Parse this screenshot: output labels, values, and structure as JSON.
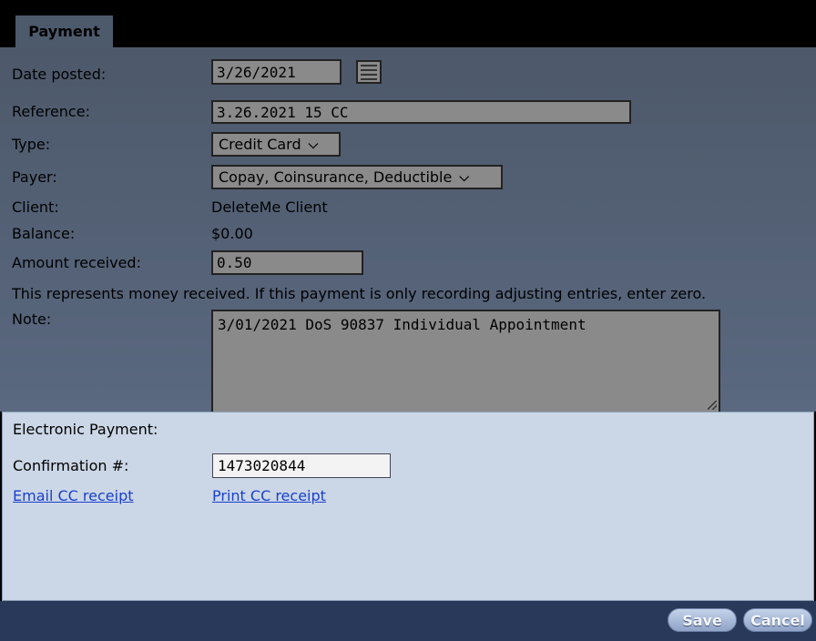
{
  "tab": {
    "label": "Payment"
  },
  "form": {
    "date_posted": {
      "label": "Date posted:",
      "value": "3/26/2021",
      "icon": "calendar-icon"
    },
    "reference": {
      "label": "Reference:",
      "value": "3.26.2021 15 CC"
    },
    "type": {
      "label": "Type:",
      "selected": "Credit Card"
    },
    "payer": {
      "label": "Payer:",
      "selected": "Copay, Coinsurance, Deductible"
    },
    "client": {
      "label": "Client:",
      "value": "DeleteMe Client"
    },
    "balance": {
      "label": "Balance:",
      "value": "$0.00"
    },
    "amount_received": {
      "label": "Amount received:",
      "value": "0.50"
    },
    "hint": "This represents money received. If this payment is only recording adjusting entries, enter zero.",
    "note": {
      "label": "Note:",
      "value": "3/01/2021 DoS 90837 Individual Appointment"
    }
  },
  "electronic": {
    "title": "Electronic Payment:",
    "confirmation_label": "Confirmation #:",
    "confirmation_value": "1473020844",
    "email_link": "Email CC receipt",
    "print_link": "Print CC receipt"
  },
  "footer": {
    "save_label": "Save",
    "cancel_label": "Cancel"
  },
  "colors": {
    "upper_bg": "#4d596a",
    "lower_bg": "#cbd7e6",
    "footer_bg": "#29395a",
    "link": "#1a3fd0"
  }
}
